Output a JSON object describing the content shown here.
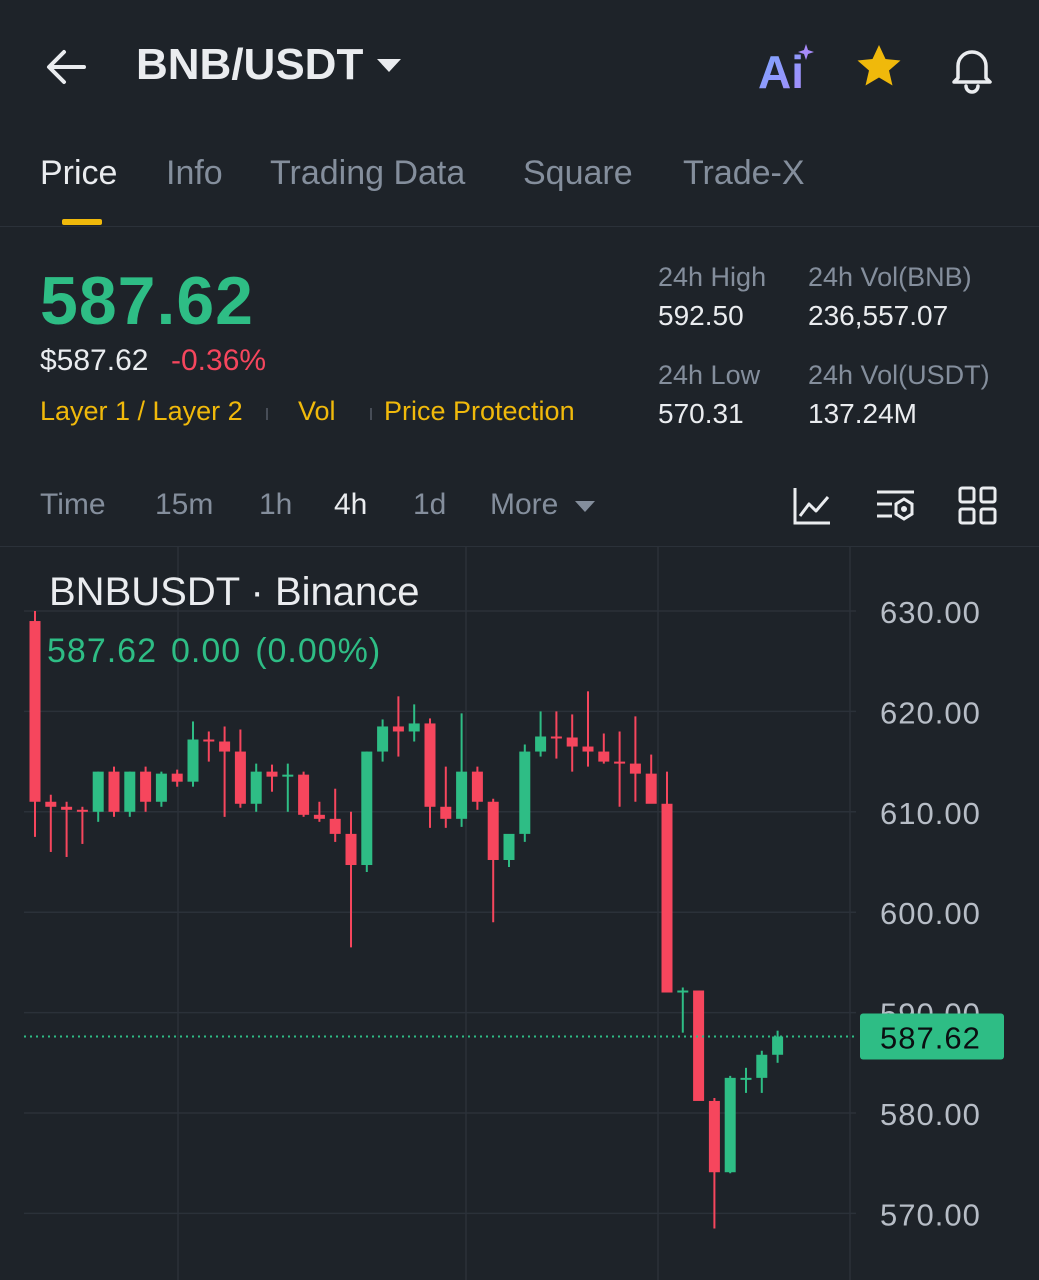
{
  "header": {
    "pair": "BNB/USDT",
    "ai_label": "Ai"
  },
  "tabs": [
    "Price",
    "Info",
    "Trading Data",
    "Square",
    "Trade-X"
  ],
  "price": {
    "last": "587.62",
    "usd": "$587.62",
    "change_pct": "-0.36%"
  },
  "tags": [
    "Layer 1 / Layer 2",
    "Vol",
    "Price Protection"
  ],
  "stats": {
    "high_label": "24h High",
    "high_value": "592.50",
    "low_label": "24h Low",
    "low_value": "570.31",
    "vol_base_label": "24h Vol(BNB)",
    "vol_base_value": "236,557.07",
    "vol_quote_label": "24h Vol(USDT)",
    "vol_quote_value": "137.24M"
  },
  "intervals": [
    "Time",
    "15m",
    "1h",
    "4h",
    "1d",
    "More"
  ],
  "active_interval": "4h",
  "chart": {
    "symbol_title": "BNBUSDT · Binance",
    "ohlc_close": "587.62",
    "ohlc_change": "0.00",
    "ohlc_change_pct": "(0.00%)",
    "current_price_label": "587.62"
  },
  "colors": {
    "up": "#2ebd85",
    "down": "#f6465d",
    "accent": "#f0b90b",
    "background": "#1e2329"
  },
  "icons": [
    "back-arrow-icon",
    "dropdown-caret-icon",
    "ai-icon",
    "star-icon",
    "bell-icon",
    "indicator-chart-icon",
    "chart-settings-icon",
    "grid-layout-icon"
  ],
  "chart_data": {
    "type": "candlestick",
    "ylim": [
      565,
      634
    ],
    "y_ticks": [
      630,
      620,
      610,
      600,
      590,
      580,
      570
    ],
    "y_tick_labels": [
      "630.00",
      "620.00",
      "610.00",
      "600.00",
      "590.00",
      "580.00",
      "570.00"
    ],
    "current_price": 587.62,
    "candles": [
      {
        "o": 629,
        "h": 630,
        "l": 607.5,
        "c": 611
      },
      {
        "o": 611,
        "h": 611.7,
        "l": 606,
        "c": 610.5
      },
      {
        "o": 610.5,
        "h": 611,
        "l": 605.5,
        "c": 610.2
      },
      {
        "o": 610.2,
        "h": 610.5,
        "l": 606.8,
        "c": 610
      },
      {
        "o": 610,
        "h": 614,
        "l": 609,
        "c": 614
      },
      {
        "o": 614,
        "h": 614.5,
        "l": 609.5,
        "c": 610
      },
      {
        "o": 610,
        "h": 614,
        "l": 609.5,
        "c": 614
      },
      {
        "o": 614,
        "h": 614.5,
        "l": 610,
        "c": 611
      },
      {
        "o": 611,
        "h": 614,
        "l": 610.5,
        "c": 613.8
      },
      {
        "o": 613.8,
        "h": 614.2,
        "l": 612.5,
        "c": 613
      },
      {
        "o": 613,
        "h": 619,
        "l": 612.5,
        "c": 617.2
      },
      {
        "o": 617.2,
        "h": 618,
        "l": 615,
        "c": 617
      },
      {
        "o": 617,
        "h": 618.5,
        "l": 609.5,
        "c": 616
      },
      {
        "o": 616,
        "h": 618.2,
        "l": 610.4,
        "c": 610.8
      },
      {
        "o": 610.8,
        "h": 614.8,
        "l": 610,
        "c": 614
      },
      {
        "o": 614,
        "h": 614.7,
        "l": 612,
        "c": 613.5
      },
      {
        "o": 613.5,
        "h": 614.8,
        "l": 610,
        "c": 613.7
      },
      {
        "o": 613.7,
        "h": 614,
        "l": 609.5,
        "c": 609.7
      },
      {
        "o": 609.7,
        "h": 611,
        "l": 609,
        "c": 609.3
      },
      {
        "o": 609.3,
        "h": 612.3,
        "l": 607,
        "c": 607.8
      },
      {
        "o": 607.8,
        "h": 610,
        "l": 596.5,
        "c": 604.7
      },
      {
        "o": 604.7,
        "h": 616,
        "l": 604,
        "c": 616
      },
      {
        "o": 616,
        "h": 619.2,
        "l": 615,
        "c": 618.5
      },
      {
        "o": 618.5,
        "h": 621.5,
        "l": 615.5,
        "c": 618
      },
      {
        "o": 618,
        "h": 620.7,
        "l": 617,
        "c": 618.8
      },
      {
        "o": 618.8,
        "h": 619.3,
        "l": 608.4,
        "c": 610.5
      },
      {
        "o": 610.5,
        "h": 614.5,
        "l": 608.4,
        "c": 609.3
      },
      {
        "o": 609.3,
        "h": 619.8,
        "l": 608.5,
        "c": 614
      },
      {
        "o": 614,
        "h": 614.5,
        "l": 610.2,
        "c": 611
      },
      {
        "o": 611,
        "h": 611.3,
        "l": 599,
        "c": 605.2
      },
      {
        "o": 605.2,
        "h": 607.5,
        "l": 604.5,
        "c": 607.8
      },
      {
        "o": 607.8,
        "h": 616.7,
        "l": 607,
        "c": 616
      },
      {
        "o": 616,
        "h": 620,
        "l": 615.5,
        "c": 617.5
      },
      {
        "o": 617.5,
        "h": 620,
        "l": 615.3,
        "c": 617.4
      },
      {
        "o": 617.4,
        "h": 619.7,
        "l": 614,
        "c": 616.5
      },
      {
        "o": 616.5,
        "h": 622,
        "l": 614.5,
        "c": 616
      },
      {
        "o": 616,
        "h": 617.8,
        "l": 614.8,
        "c": 615
      },
      {
        "o": 615,
        "h": 618,
        "l": 610.5,
        "c": 614.8
      },
      {
        "o": 614.8,
        "h": 619.5,
        "l": 611,
        "c": 613.8
      },
      {
        "o": 613.8,
        "h": 615.7,
        "l": 611.5,
        "c": 610.8
      },
      {
        "o": 610.8,
        "h": 614,
        "l": 608,
        "c": 592
      },
      {
        "o": 592,
        "h": 592.5,
        "l": 588,
        "c": 592.2
      },
      {
        "o": 592.2,
        "h": 592.2,
        "l": 582,
        "c": 581.2
      },
      {
        "o": 581.2,
        "h": 581.5,
        "l": 568.5,
        "c": 574.1
      },
      {
        "o": 574.1,
        "h": 583.7,
        "l": 574,
        "c": 583.5
      },
      {
        "o": 583.5,
        "h": 584.5,
        "l": 582,
        "c": 583.5
      },
      {
        "o": 583.5,
        "h": 586.2,
        "l": 582,
        "c": 585.8
      },
      {
        "o": 585.8,
        "h": 588.2,
        "l": 585,
        "c": 587.62
      }
    ]
  }
}
